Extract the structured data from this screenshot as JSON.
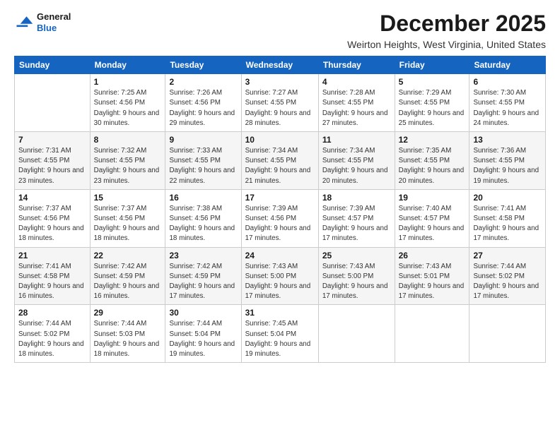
{
  "logo": {
    "line1": "General",
    "line2": "Blue"
  },
  "title": "December 2025",
  "subtitle": "Weirton Heights, West Virginia, United States",
  "weekdays": [
    "Sunday",
    "Monday",
    "Tuesday",
    "Wednesday",
    "Thursday",
    "Friday",
    "Saturday"
  ],
  "weeks": [
    [
      {
        "day": "",
        "sunrise": "",
        "sunset": "",
        "daylight": ""
      },
      {
        "day": "1",
        "sunrise": "Sunrise: 7:25 AM",
        "sunset": "Sunset: 4:56 PM",
        "daylight": "Daylight: 9 hours and 30 minutes."
      },
      {
        "day": "2",
        "sunrise": "Sunrise: 7:26 AM",
        "sunset": "Sunset: 4:56 PM",
        "daylight": "Daylight: 9 hours and 29 minutes."
      },
      {
        "day": "3",
        "sunrise": "Sunrise: 7:27 AM",
        "sunset": "Sunset: 4:55 PM",
        "daylight": "Daylight: 9 hours and 28 minutes."
      },
      {
        "day": "4",
        "sunrise": "Sunrise: 7:28 AM",
        "sunset": "Sunset: 4:55 PM",
        "daylight": "Daylight: 9 hours and 27 minutes."
      },
      {
        "day": "5",
        "sunrise": "Sunrise: 7:29 AM",
        "sunset": "Sunset: 4:55 PM",
        "daylight": "Daylight: 9 hours and 25 minutes."
      },
      {
        "day": "6",
        "sunrise": "Sunrise: 7:30 AM",
        "sunset": "Sunset: 4:55 PM",
        "daylight": "Daylight: 9 hours and 24 minutes."
      }
    ],
    [
      {
        "day": "7",
        "sunrise": "Sunrise: 7:31 AM",
        "sunset": "Sunset: 4:55 PM",
        "daylight": "Daylight: 9 hours and 23 minutes."
      },
      {
        "day": "8",
        "sunrise": "Sunrise: 7:32 AM",
        "sunset": "Sunset: 4:55 PM",
        "daylight": "Daylight: 9 hours and 23 minutes."
      },
      {
        "day": "9",
        "sunrise": "Sunrise: 7:33 AM",
        "sunset": "Sunset: 4:55 PM",
        "daylight": "Daylight: 9 hours and 22 minutes."
      },
      {
        "day": "10",
        "sunrise": "Sunrise: 7:34 AM",
        "sunset": "Sunset: 4:55 PM",
        "daylight": "Daylight: 9 hours and 21 minutes."
      },
      {
        "day": "11",
        "sunrise": "Sunrise: 7:34 AM",
        "sunset": "Sunset: 4:55 PM",
        "daylight": "Daylight: 9 hours and 20 minutes."
      },
      {
        "day": "12",
        "sunrise": "Sunrise: 7:35 AM",
        "sunset": "Sunset: 4:55 PM",
        "daylight": "Daylight: 9 hours and 20 minutes."
      },
      {
        "day": "13",
        "sunrise": "Sunrise: 7:36 AM",
        "sunset": "Sunset: 4:55 PM",
        "daylight": "Daylight: 9 hours and 19 minutes."
      }
    ],
    [
      {
        "day": "14",
        "sunrise": "Sunrise: 7:37 AM",
        "sunset": "Sunset: 4:56 PM",
        "daylight": "Daylight: 9 hours and 18 minutes."
      },
      {
        "day": "15",
        "sunrise": "Sunrise: 7:37 AM",
        "sunset": "Sunset: 4:56 PM",
        "daylight": "Daylight: 9 hours and 18 minutes."
      },
      {
        "day": "16",
        "sunrise": "Sunrise: 7:38 AM",
        "sunset": "Sunset: 4:56 PM",
        "daylight": "Daylight: 9 hours and 18 minutes."
      },
      {
        "day": "17",
        "sunrise": "Sunrise: 7:39 AM",
        "sunset": "Sunset: 4:56 PM",
        "daylight": "Daylight: 9 hours and 17 minutes."
      },
      {
        "day": "18",
        "sunrise": "Sunrise: 7:39 AM",
        "sunset": "Sunset: 4:57 PM",
        "daylight": "Daylight: 9 hours and 17 minutes."
      },
      {
        "day": "19",
        "sunrise": "Sunrise: 7:40 AM",
        "sunset": "Sunset: 4:57 PM",
        "daylight": "Daylight: 9 hours and 17 minutes."
      },
      {
        "day": "20",
        "sunrise": "Sunrise: 7:41 AM",
        "sunset": "Sunset: 4:58 PM",
        "daylight": "Daylight: 9 hours and 17 minutes."
      }
    ],
    [
      {
        "day": "21",
        "sunrise": "Sunrise: 7:41 AM",
        "sunset": "Sunset: 4:58 PM",
        "daylight": "Daylight: 9 hours and 16 minutes."
      },
      {
        "day": "22",
        "sunrise": "Sunrise: 7:42 AM",
        "sunset": "Sunset: 4:59 PM",
        "daylight": "Daylight: 9 hours and 16 minutes."
      },
      {
        "day": "23",
        "sunrise": "Sunrise: 7:42 AM",
        "sunset": "Sunset: 4:59 PM",
        "daylight": "Daylight: 9 hours and 17 minutes."
      },
      {
        "day": "24",
        "sunrise": "Sunrise: 7:43 AM",
        "sunset": "Sunset: 5:00 PM",
        "daylight": "Daylight: 9 hours and 17 minutes."
      },
      {
        "day": "25",
        "sunrise": "Sunrise: 7:43 AM",
        "sunset": "Sunset: 5:00 PM",
        "daylight": "Daylight: 9 hours and 17 minutes."
      },
      {
        "day": "26",
        "sunrise": "Sunrise: 7:43 AM",
        "sunset": "Sunset: 5:01 PM",
        "daylight": "Daylight: 9 hours and 17 minutes."
      },
      {
        "day": "27",
        "sunrise": "Sunrise: 7:44 AM",
        "sunset": "Sunset: 5:02 PM",
        "daylight": "Daylight: 9 hours and 17 minutes."
      }
    ],
    [
      {
        "day": "28",
        "sunrise": "Sunrise: 7:44 AM",
        "sunset": "Sunset: 5:02 PM",
        "daylight": "Daylight: 9 hours and 18 minutes."
      },
      {
        "day": "29",
        "sunrise": "Sunrise: 7:44 AM",
        "sunset": "Sunset: 5:03 PM",
        "daylight": "Daylight: 9 hours and 18 minutes."
      },
      {
        "day": "30",
        "sunrise": "Sunrise: 7:44 AM",
        "sunset": "Sunset: 5:04 PM",
        "daylight": "Daylight: 9 hours and 19 minutes."
      },
      {
        "day": "31",
        "sunrise": "Sunrise: 7:45 AM",
        "sunset": "Sunset: 5:04 PM",
        "daylight": "Daylight: 9 hours and 19 minutes."
      },
      {
        "day": "",
        "sunrise": "",
        "sunset": "",
        "daylight": ""
      },
      {
        "day": "",
        "sunrise": "",
        "sunset": "",
        "daylight": ""
      },
      {
        "day": "",
        "sunrise": "",
        "sunset": "",
        "daylight": ""
      }
    ]
  ]
}
